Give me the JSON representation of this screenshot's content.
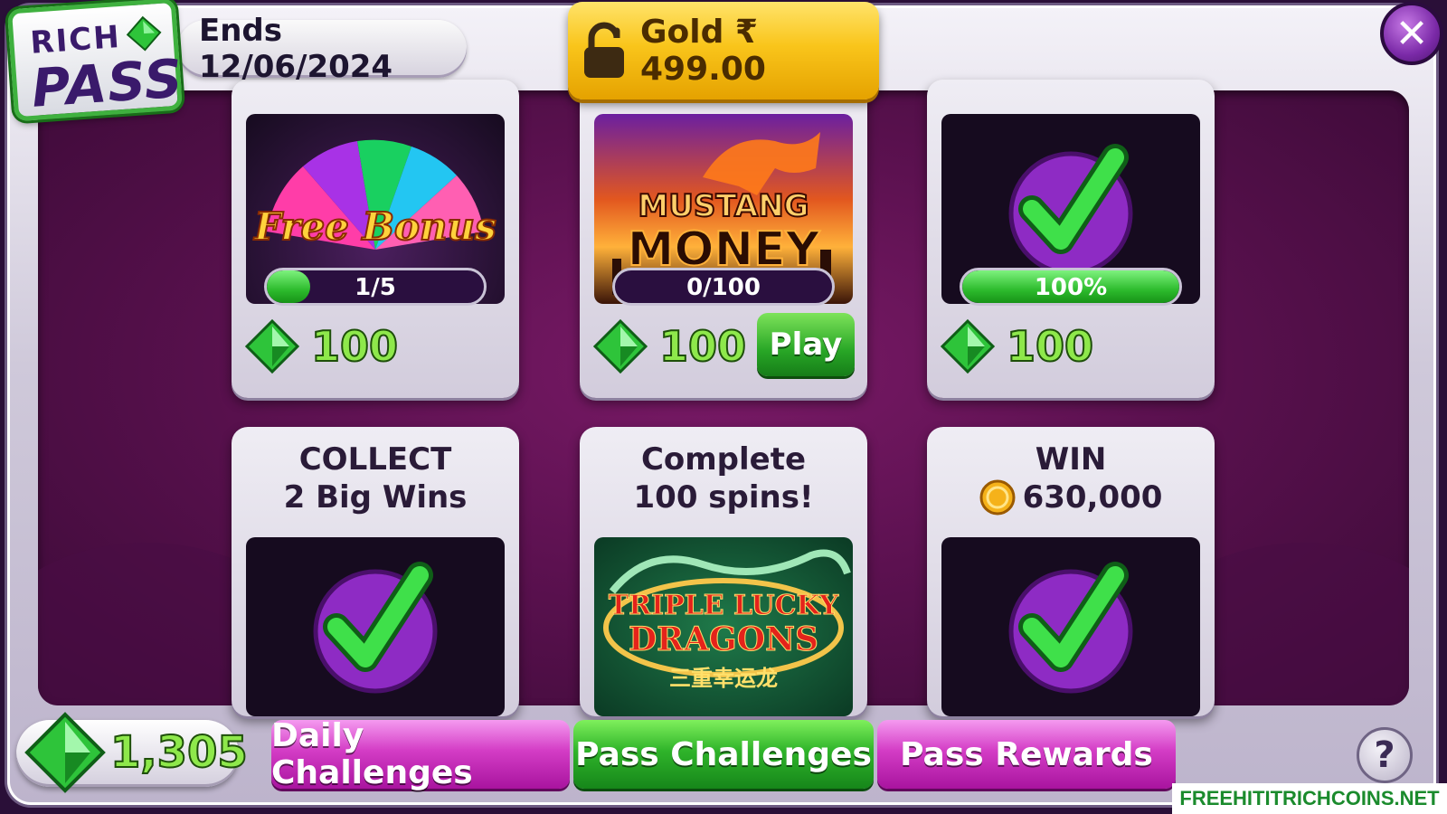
{
  "header": {
    "logo_top": "RICH",
    "logo_bottom": "PASS",
    "ends_text": "Ends 12/06/2024",
    "gold_label": "Gold ₹ 499.00",
    "close_symbol": "✕"
  },
  "cards": [
    {
      "art_title": "Free Bonus",
      "progress": {
        "label": "1/5",
        "fraction": 0.2
      },
      "reward": "100",
      "state": "in-progress"
    },
    {
      "art_title_line1": "MUSTANG",
      "art_title_line2": "MONEY",
      "progress": {
        "label": "0/100",
        "fraction": 0
      },
      "reward": "100",
      "play_label": "Play",
      "state": "in-progress"
    },
    {
      "progress": {
        "label": "100%",
        "fraction": 1
      },
      "reward": "100",
      "state": "complete"
    },
    {
      "title_line1": "COLLECT",
      "title_line2": "2 Big Wins",
      "state": "complete"
    },
    {
      "title_line1": "Complete",
      "title_line2": "100 spins!",
      "art_title_line1": "TRIPLE LUCKY",
      "art_title_line2": "DRAGONS",
      "art_subtitle": "三重幸运龙",
      "state": "locked"
    },
    {
      "title_line1": "WIN",
      "title_line2": "630,000",
      "state": "complete"
    }
  ],
  "footer": {
    "gem_total": "1,305",
    "tabs": [
      {
        "label": "Daily Challenges",
        "active": false
      },
      {
        "label": "Pass Challenges",
        "active": true
      },
      {
        "label": "Pass Rewards",
        "active": false
      }
    ],
    "help_symbol": "?"
  },
  "watermark": "FREEHITITRICHCOINS.NET",
  "colors": {
    "gem_green": "#2dbb2d",
    "tab_pink": "#d33cc5",
    "tab_active_green": "#2fb42a",
    "gold": "#f9c51b",
    "check_purple": "#8e2bc4"
  },
  "icons": [
    "gem-icon",
    "lock-icon",
    "close-icon",
    "check-icon",
    "coin-icon",
    "help-icon"
  ]
}
